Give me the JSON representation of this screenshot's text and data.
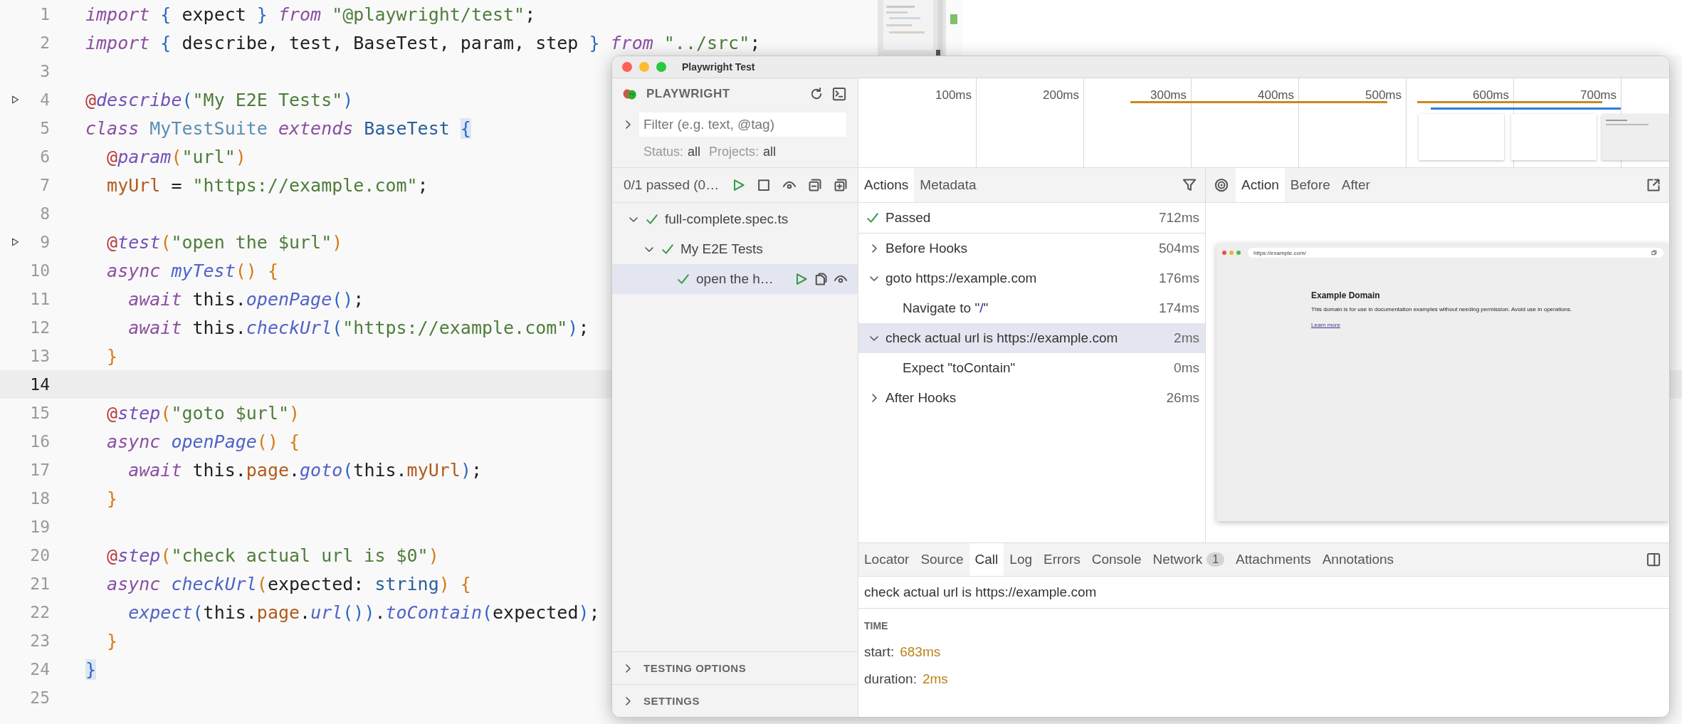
{
  "editor": {
    "lines": [
      {
        "number": "1",
        "run": false,
        "current": false,
        "tokens": [
          {
            "kind": "kw",
            "text": "import"
          },
          {
            "kind": "b1",
            "text": " {"
          },
          {
            "kind": "p",
            "text": " expect "
          },
          {
            "kind": "b1",
            "text": "}"
          },
          {
            "kind": "kw",
            "text": " from"
          },
          {
            "kind": "str",
            "text": " \"@playwright/test\""
          },
          {
            "kind": "p",
            "text": ";"
          }
        ]
      },
      {
        "number": "2",
        "run": false,
        "current": false,
        "tokens": [
          {
            "kind": "kw",
            "text": "import"
          },
          {
            "kind": "b1",
            "text": " {"
          },
          {
            "kind": "p",
            "text": " describe, test, BaseTest, param, step "
          },
          {
            "kind": "b1",
            "text": "}"
          },
          {
            "kind": "kw",
            "text": " from"
          },
          {
            "kind": "str",
            "text": " \"../src\""
          },
          {
            "kind": "p",
            "text": ";"
          }
        ]
      },
      {
        "number": "3",
        "run": false,
        "current": false
      },
      {
        "number": "4",
        "run": true,
        "current": false,
        "tokens": [
          {
            "kind": "at",
            "text": "@"
          },
          {
            "kind": "deco",
            "text": "describe"
          },
          {
            "kind": "b1",
            "text": "("
          },
          {
            "kind": "str",
            "text": "\"My E2E Tests\""
          },
          {
            "kind": "b1",
            "text": ")"
          }
        ]
      },
      {
        "number": "5",
        "run": false,
        "current": false,
        "tokens": [
          {
            "kind": "kw",
            "text": "class"
          },
          {
            "kind": "cls",
            "text": " MyTestSuite"
          },
          {
            "kind": "kw",
            "text": " extends"
          },
          {
            "kind": "type",
            "text": " BaseTest "
          },
          {
            "kind": "bm",
            "text": "{"
          }
        ]
      },
      {
        "number": "6",
        "run": false,
        "current": false,
        "tokens": [
          {
            "kind": "at",
            "text": "  @"
          },
          {
            "kind": "deco",
            "text": "param"
          },
          {
            "kind": "b2",
            "text": "("
          },
          {
            "kind": "str",
            "text": "\"url\""
          },
          {
            "kind": "b2",
            "text": ")"
          }
        ]
      },
      {
        "number": "7",
        "run": false,
        "current": false,
        "tokens": [
          {
            "kind": "mem",
            "text": "  myUrl"
          },
          {
            "kind": "p",
            "text": " = "
          },
          {
            "kind": "str",
            "text": "\"https://example.com\""
          },
          {
            "kind": "p",
            "text": ";"
          }
        ]
      },
      {
        "number": "8",
        "run": false,
        "current": false
      },
      {
        "number": "9",
        "run": true,
        "current": false,
        "tokens": [
          {
            "kind": "at",
            "text": "  @"
          },
          {
            "kind": "deco",
            "text": "test"
          },
          {
            "kind": "b2",
            "text": "("
          },
          {
            "kind": "str",
            "text": "\"open the $url\""
          },
          {
            "kind": "b2",
            "text": ")"
          }
        ]
      },
      {
        "number": "10",
        "run": false,
        "current": false,
        "tokens": [
          {
            "kind": "kw",
            "text": "  async"
          },
          {
            "kind": "fn",
            "text": " myTest"
          },
          {
            "kind": "b2",
            "text": "()"
          },
          {
            "kind": "b2",
            "text": " {"
          }
        ]
      },
      {
        "number": "11",
        "run": false,
        "current": false,
        "tokens": [
          {
            "kind": "kw",
            "text": "    await"
          },
          {
            "kind": "p",
            "text": " this."
          },
          {
            "kind": "fn",
            "text": "openPage"
          },
          {
            "kind": "b1",
            "text": "()"
          },
          {
            "kind": "p",
            "text": ";"
          }
        ]
      },
      {
        "number": "12",
        "run": false,
        "current": false,
        "tokens": [
          {
            "kind": "kw",
            "text": "    await"
          },
          {
            "kind": "p",
            "text": " this."
          },
          {
            "kind": "fn",
            "text": "checkUrl"
          },
          {
            "kind": "b1",
            "text": "("
          },
          {
            "kind": "str",
            "text": "\"https://example.com\""
          },
          {
            "kind": "b1",
            "text": ")"
          },
          {
            "kind": "p",
            "text": ";"
          }
        ]
      },
      {
        "number": "13",
        "run": false,
        "current": false,
        "tokens": [
          {
            "kind": "b2",
            "text": "  }"
          }
        ]
      },
      {
        "number": "14",
        "run": false,
        "current": true
      },
      {
        "number": "15",
        "run": false,
        "current": false,
        "tokens": [
          {
            "kind": "at",
            "text": "  @"
          },
          {
            "kind": "deco",
            "text": "step"
          },
          {
            "kind": "b2",
            "text": "("
          },
          {
            "kind": "str",
            "text": "\"goto $url\""
          },
          {
            "kind": "b2",
            "text": ")"
          }
        ]
      },
      {
        "number": "16",
        "run": false,
        "current": false,
        "tokens": [
          {
            "kind": "kw",
            "text": "  async"
          },
          {
            "kind": "fn",
            "text": " openPage"
          },
          {
            "kind": "b2",
            "text": "()"
          },
          {
            "kind": "b2",
            "text": " {"
          }
        ]
      },
      {
        "number": "17",
        "run": false,
        "current": false,
        "tokens": [
          {
            "kind": "kw",
            "text": "    await"
          },
          {
            "kind": "p",
            "text": " this."
          },
          {
            "kind": "mem",
            "text": "page"
          },
          {
            "kind": "p",
            "text": "."
          },
          {
            "kind": "fn",
            "text": "goto"
          },
          {
            "kind": "b1",
            "text": "("
          },
          {
            "kind": "p",
            "text": "this."
          },
          {
            "kind": "mem",
            "text": "myUrl"
          },
          {
            "kind": "b1",
            "text": ")"
          },
          {
            "kind": "p",
            "text": ";"
          }
        ]
      },
      {
        "number": "18",
        "run": false,
        "current": false,
        "tokens": [
          {
            "kind": "b2",
            "text": "  }"
          }
        ]
      },
      {
        "number": "19",
        "run": false,
        "current": false
      },
      {
        "number": "20",
        "run": false,
        "current": false,
        "tokens": [
          {
            "kind": "at",
            "text": "  @"
          },
          {
            "kind": "deco",
            "text": "step"
          },
          {
            "kind": "b2",
            "text": "("
          },
          {
            "kind": "str",
            "text": "\"check actual url is $0\""
          },
          {
            "kind": "b2",
            "text": ")"
          }
        ]
      },
      {
        "number": "21",
        "run": false,
        "current": false,
        "tokens": [
          {
            "kind": "kw",
            "text": "  async"
          },
          {
            "kind": "fn",
            "text": " checkUrl"
          },
          {
            "kind": "b2",
            "text": "("
          },
          {
            "kind": "p",
            "text": "expected: "
          },
          {
            "kind": "type",
            "text": "string"
          },
          {
            "kind": "b2",
            "text": ")"
          },
          {
            "kind": "b2",
            "text": " {"
          }
        ]
      },
      {
        "number": "22",
        "run": false,
        "current": false,
        "tokens": [
          {
            "kind": "fn",
            "text": "    expect"
          },
          {
            "kind": "b1",
            "text": "("
          },
          {
            "kind": "p",
            "text": "this."
          },
          {
            "kind": "mem",
            "text": "page"
          },
          {
            "kind": "p",
            "text": "."
          },
          {
            "kind": "fn",
            "text": "url"
          },
          {
            "kind": "b1",
            "text": "())"
          },
          {
            "kind": "p",
            "text": "."
          },
          {
            "kind": "fn",
            "text": "toContain"
          },
          {
            "kind": "b1",
            "text": "("
          },
          {
            "kind": "p",
            "text": "expected"
          },
          {
            "kind": "b1",
            "text": ")"
          },
          {
            "kind": "p",
            "text": ";"
          }
        ]
      },
      {
        "number": "23",
        "run": false,
        "current": false,
        "tokens": [
          {
            "kind": "b2",
            "text": "  }"
          }
        ]
      },
      {
        "number": "24",
        "run": false,
        "current": false,
        "tokens": [
          {
            "kind": "bm",
            "text": "}"
          }
        ]
      },
      {
        "number": "25",
        "run": false,
        "current": false
      }
    ]
  },
  "window": {
    "title": "Playwright Test"
  },
  "sidebar": {
    "brand": "PLAYWRIGHT",
    "filter": {
      "placeholder": "Filter (e.g. text, @tag)"
    },
    "status_label": "Status:",
    "status_value": "all",
    "projects_label": "Projects:",
    "projects_value": "all",
    "summary": "0/1 passed (0…",
    "tree": [
      {
        "label": "full-complete.spec.ts",
        "expanded": true,
        "selected": false,
        "children": [
          {
            "label": "My E2E Tests",
            "expanded": true,
            "selected": false,
            "children": [
              {
                "label": "open the h…",
                "selected": true
              }
            ]
          }
        ]
      }
    ],
    "sections": [
      {
        "label": "TESTING OPTIONS",
        "expanded": false
      },
      {
        "label": "SETTINGS",
        "expanded": false
      }
    ]
  },
  "timeline": {
    "ticks": [
      "100ms",
      "200ms",
      "300ms",
      "400ms",
      "500ms",
      "600ms",
      "700ms"
    ]
  },
  "actions_panel": {
    "tabs": [
      {
        "label": "Actions",
        "selected": true
      },
      {
        "label": "Metadata",
        "selected": false
      }
    ],
    "status": {
      "label": "Passed",
      "duration": "712ms"
    },
    "actions": [
      {
        "label": "Before Hooks",
        "duration": "504ms",
        "expanded": false,
        "selected": false
      },
      {
        "label": "goto https://example.com",
        "duration": "176ms",
        "expanded": true,
        "selected": false,
        "children": [
          {
            "parts": [
              {
                "text": "Navigate to \"",
                "kind": "plain"
              },
              {
                "text": "/",
                "kind": "param"
              },
              {
                "text": "\"",
                "kind": "plain"
              }
            ],
            "duration": "174ms",
            "selected": false
          }
        ]
      },
      {
        "label": "check actual url is https://example.com",
        "duration": "2ms",
        "expanded": true,
        "selected": true,
        "children": [
          {
            "label": "Expect \"toContain\"",
            "duration": "0ms",
            "selected": false
          }
        ]
      },
      {
        "label": "After Hooks",
        "duration": "26ms",
        "expanded": false,
        "selected": false
      }
    ]
  },
  "snapshot_panel": {
    "tabs": [
      {
        "label": "Action",
        "selected": true
      },
      {
        "label": "Before",
        "selected": false
      },
      {
        "label": "After",
        "selected": false
      }
    ],
    "page": {
      "url": "https://example.com/",
      "heading": "Example Domain",
      "text": "This domain is for use in documentation examples without needing permission. Avoid use in operations.",
      "link": "Learn more"
    }
  },
  "details_panel": {
    "tabs": [
      {
        "label": "Locator",
        "selected": false
      },
      {
        "label": "Source",
        "selected": false
      },
      {
        "label": "Call",
        "selected": true
      },
      {
        "label": "Log",
        "selected": false
      },
      {
        "label": "Errors",
        "selected": false
      },
      {
        "label": "Console",
        "selected": false
      },
      {
        "label": "Network",
        "badge": "1",
        "selected": false
      },
      {
        "label": "Attachments",
        "selected": false
      },
      {
        "label": "Annotations",
        "selected": false
      }
    ],
    "call_title": "check actual url is https://example.com",
    "section": "TIME",
    "fields": [
      {
        "label": "start:",
        "value": "683ms"
      },
      {
        "label": "duration:",
        "value": "2ms"
      }
    ]
  }
}
